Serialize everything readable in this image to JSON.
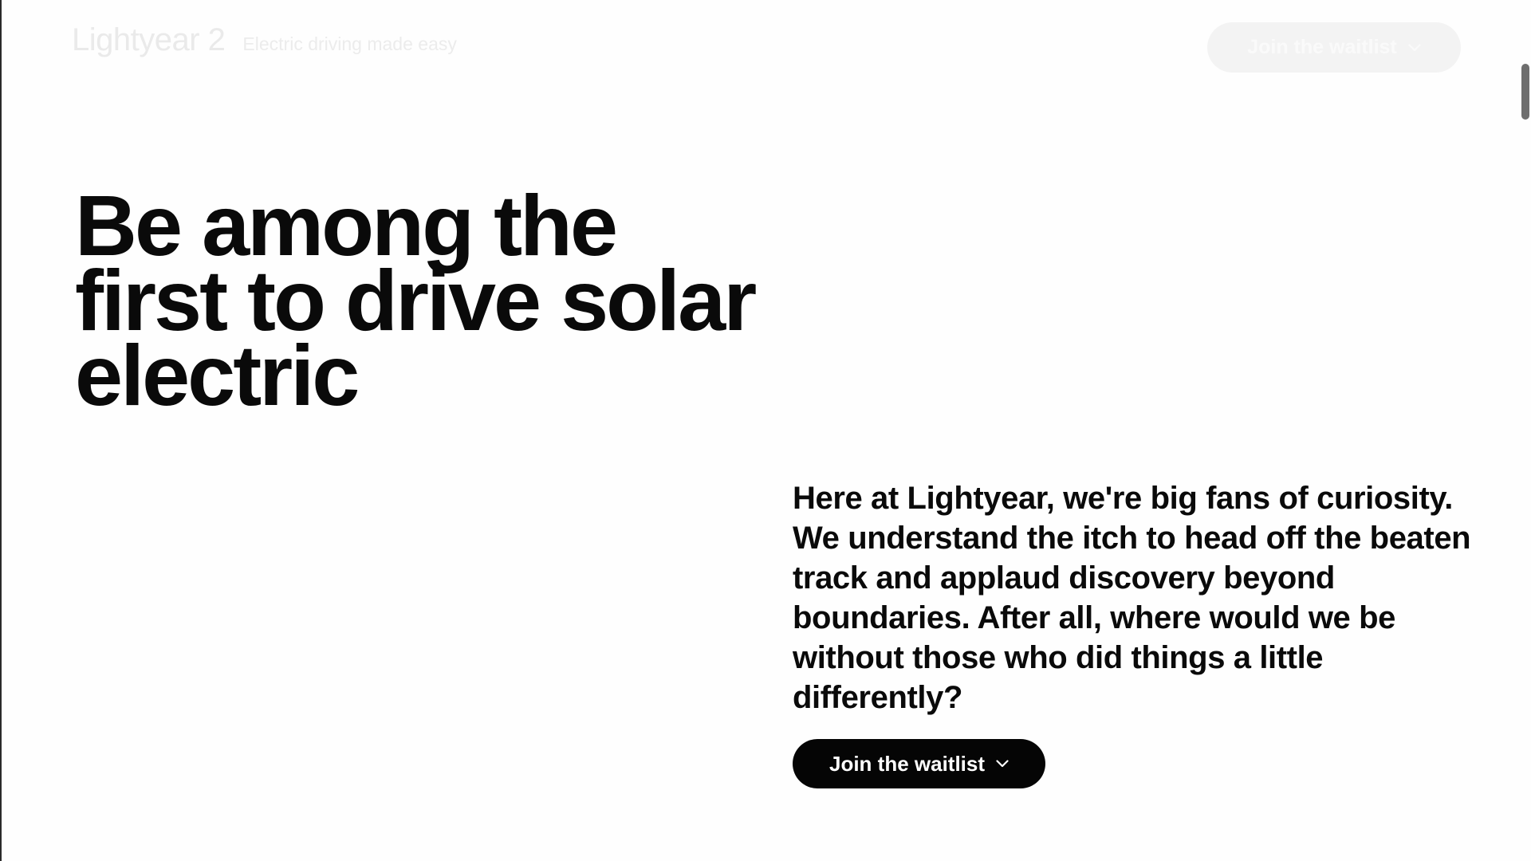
{
  "header": {
    "brand": "Lightyear 2",
    "tagline": "Electric driving made easy",
    "cta_label": "Join the waitlist",
    "cta_icon": "chevron-down-icon"
  },
  "hero": {
    "title": "Be among the first to drive solar electric"
  },
  "intro": {
    "text": "Here at Lightyear, we're big fans of curiosity. We understand the itch to head off the beaten track and applaud discovery beyond boundaries. After all, where would we be without those who did things a little differently?",
    "cta_label": "Join the waitlist",
    "cta_icon": "chevron-down-icon"
  },
  "colors": {
    "background": "#fefefe",
    "text": "#0a0a0a",
    "primary_button": "#050505",
    "faded_header": "#f3f3f3"
  }
}
